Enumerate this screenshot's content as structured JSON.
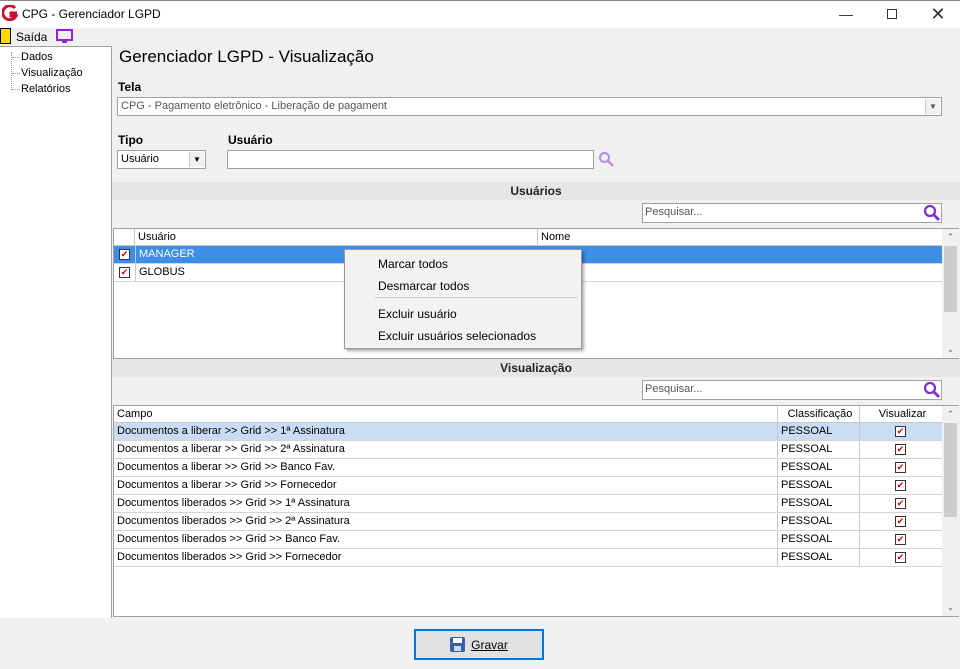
{
  "window": {
    "title": "CPG - Gerenciador LGPD"
  },
  "toolbar": {
    "exit_label": "Saída"
  },
  "sidebar": {
    "items": [
      {
        "label": "Dados"
      },
      {
        "label": "Visualização"
      },
      {
        "label": "Relatórios"
      }
    ]
  },
  "page": {
    "title": "Gerenciador LGPD - Visualização"
  },
  "form": {
    "tela_label": "Tela",
    "tela_value": "CPG - Pagamento eletrônico - Liberação de pagament",
    "tipo_label": "Tipo",
    "tipo_value": "Usuário",
    "usuario_label": "Usuário",
    "usuario_value": ""
  },
  "users_section": {
    "title": "Usuários",
    "search_placeholder": "Pesquisar...",
    "columns": [
      "Usuário",
      "Nome"
    ],
    "rows": [
      {
        "usuario": "MANAGER",
        "nome": "",
        "checked": true,
        "selected": true
      },
      {
        "usuario": "GLOBUS",
        "nome": "",
        "checked": true,
        "selected": false
      }
    ]
  },
  "context_menu": {
    "items": [
      "Marcar todos",
      "Desmarcar todos",
      "Excluir usuário",
      "Excluir usuários selecionados"
    ]
  },
  "view_section": {
    "title": "Visualização",
    "search_placeholder": "Pesquisar...",
    "columns": [
      "Campo",
      "Classificação",
      "Visualizar"
    ],
    "rows": [
      {
        "campo": "Documentos a liberar >> Grid >> 1ª Assinatura",
        "classificacao": "PESSOAL",
        "visualizar": true
      },
      {
        "campo": "Documentos a liberar >> Grid >> 2ª Assinatura",
        "classificacao": "PESSOAL",
        "visualizar": true
      },
      {
        "campo": "Documentos a liberar >> Grid >> Banco Fav.",
        "classificacao": "PESSOAL",
        "visualizar": true
      },
      {
        "campo": "Documentos a liberar >> Grid >> Fornecedor",
        "classificacao": "PESSOAL",
        "visualizar": true
      },
      {
        "campo": "Documentos liberados >> Grid >> 1ª Assinatura",
        "classificacao": "PESSOAL",
        "visualizar": true
      },
      {
        "campo": "Documentos liberados >> Grid >> 2ª Assinatura",
        "classificacao": "PESSOAL",
        "visualizar": true
      },
      {
        "campo": "Documentos liberados >> Grid >> Banco Fav.",
        "classificacao": "PESSOAL",
        "visualizar": true
      },
      {
        "campo": "Documentos liberados >> Grid >> Fornecedor",
        "classificacao": "PESSOAL",
        "visualizar": true
      }
    ]
  },
  "footer": {
    "save_label": "Gravar"
  },
  "colors": {
    "selection": "#3d8ee6",
    "highlight_row": "#c9dcf5",
    "accent": "#0078d7",
    "search_icon": "#7b2fd1"
  }
}
